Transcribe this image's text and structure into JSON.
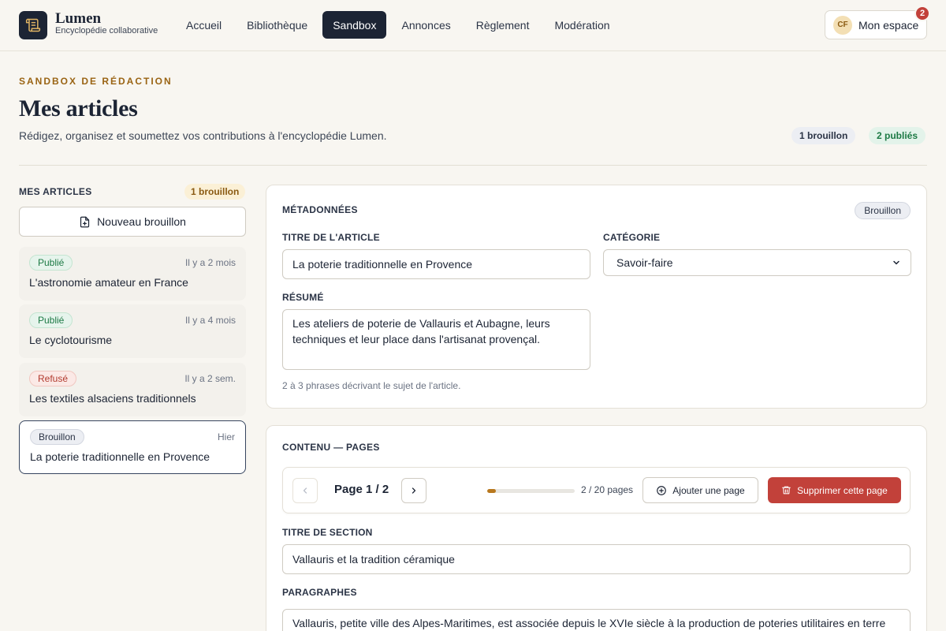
{
  "header": {
    "brand_name": "Lumen",
    "brand_tagline": "Encyclopédie collaborative",
    "nav": [
      {
        "label": "Accueil",
        "active": false
      },
      {
        "label": "Bibliothèque",
        "active": false
      },
      {
        "label": "Sandbox",
        "active": true
      },
      {
        "label": "Annonces",
        "active": false
      },
      {
        "label": "Règlement",
        "active": false
      },
      {
        "label": "Modération",
        "active": false
      }
    ],
    "account": {
      "initials": "CF",
      "label": "Mon espace",
      "notifications": "2"
    }
  },
  "page": {
    "eyebrow": "SANDBOX DE RÉDACTION",
    "title": "Mes articles",
    "subtitle": "Rédigez, organisez et soumettez vos contributions à l'encyclopédie Lumen.",
    "stats": {
      "drafts": "1 brouillon",
      "published": "2 publiés"
    }
  },
  "sidebar": {
    "title": "MES ARTICLES",
    "badge": "1 brouillon",
    "new_button": "Nouveau brouillon",
    "articles": [
      {
        "status": "Publié",
        "status_type": "pub",
        "time": "Il y a 2 mois",
        "title": "L'astronomie amateur en France",
        "selected": false
      },
      {
        "status": "Publié",
        "status_type": "pub",
        "time": "Il y a 4 mois",
        "title": "Le cyclotourisme",
        "selected": false
      },
      {
        "status": "Refusé",
        "status_type": "ref",
        "time": "Il y a 2 sem.",
        "title": "Les textiles alsaciens traditionnels",
        "selected": false
      },
      {
        "status": "Brouillon",
        "status_type": "draft",
        "time": "Hier",
        "title": "La poterie traditionnelle en Provence",
        "selected": true
      }
    ]
  },
  "metadata": {
    "title": "MÉTADONNÉES",
    "status_badge": "Brouillon",
    "article_title_label": "TITRE DE L'ARTICLE",
    "article_title_value": "La poterie traditionnelle en Provence",
    "category_label": "CATÉGORIE",
    "category_value": "Savoir-faire",
    "summary_label": "RÉSUMÉ",
    "summary_value": "Les ateliers de poterie de Vallauris et Aubagne, leurs techniques et leur place dans l'artisanat provençal.",
    "summary_hint": "2 à 3 phrases décrivant le sujet de l'article."
  },
  "content": {
    "title": "CONTENU — PAGES",
    "page_label": "Page 1 / 2",
    "progress": 0.1,
    "page_count": "2 / 20 pages",
    "add_page": "Ajouter une page",
    "delete_page": "Supprimer cette page",
    "section_title_label": "TITRE DE SECTION",
    "section_title_value": "Vallauris et la tradition céramique",
    "paragraphs_label": "PARAGRAPHES",
    "paragraph_1": "Vallauris, petite ville des Alpes-Maritimes, est associée depuis le XVIe siècle à la production de poteries utilitaires en terre"
  },
  "colors": {
    "ink": "#1c2434",
    "accent": "#9a6414",
    "danger": "#c2413a",
    "success": "#1d7a45",
    "background": "#f8f6f1"
  }
}
